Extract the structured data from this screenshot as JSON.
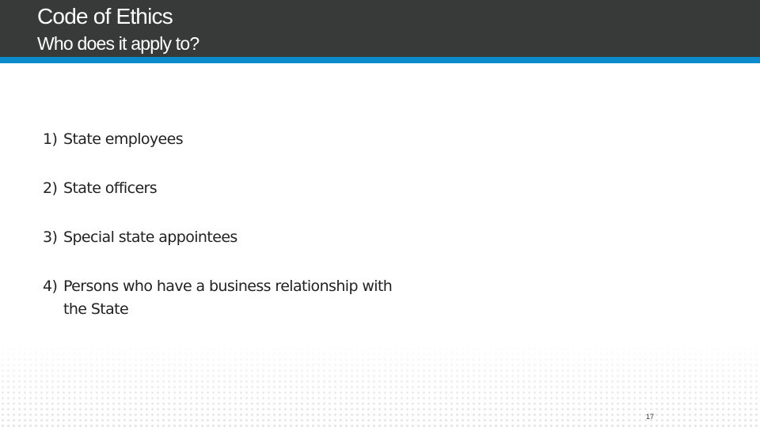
{
  "header": {
    "title": "Code of Ethics",
    "subtitle": "Who does it apply to?",
    "bg_color": "#383939",
    "accent_color": "#0b8bcb"
  },
  "list": {
    "items": [
      {
        "number": "1)",
        "text": "State employees"
      },
      {
        "number": "2)",
        "text": "State officers"
      },
      {
        "number": "3)",
        "text": "Special state appointees"
      },
      {
        "number": "4)",
        "text": "Persons who have a business relationship with the State"
      }
    ]
  },
  "footer": {
    "page_number": "17"
  }
}
